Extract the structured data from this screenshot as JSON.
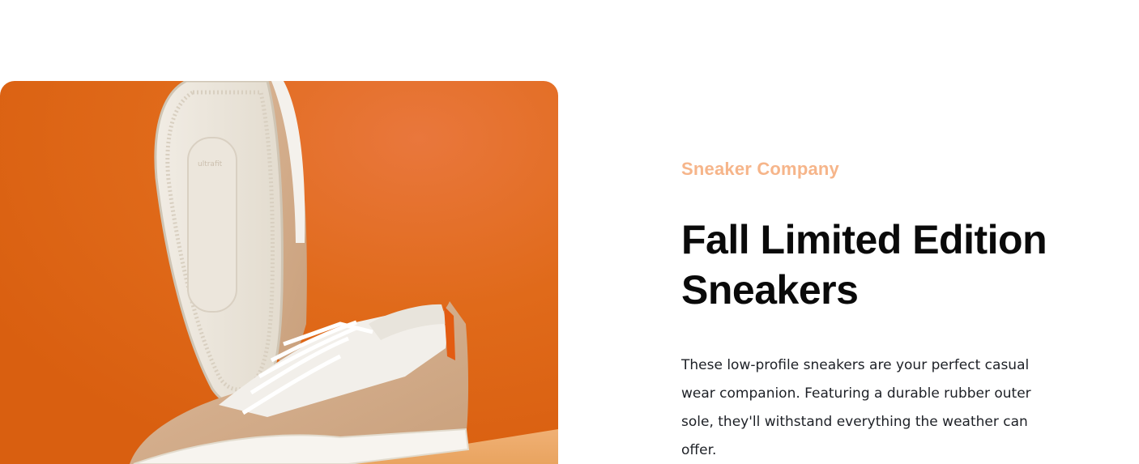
{
  "product": {
    "company": "Sneaker Company",
    "title": "Fall Limited Edition Sneakers",
    "description": "These low-profile sneakers are your perfect casual wear companion. Featuring a durable rubber outer sole, they'll withstand everything the weather can offer."
  },
  "colors": {
    "accent": "#f6b58a",
    "background_orange": "#e06a1a",
    "title": "#0a0a0a",
    "body_text": "#1d2026"
  },
  "image": {
    "icon": "sneaker-photo"
  }
}
